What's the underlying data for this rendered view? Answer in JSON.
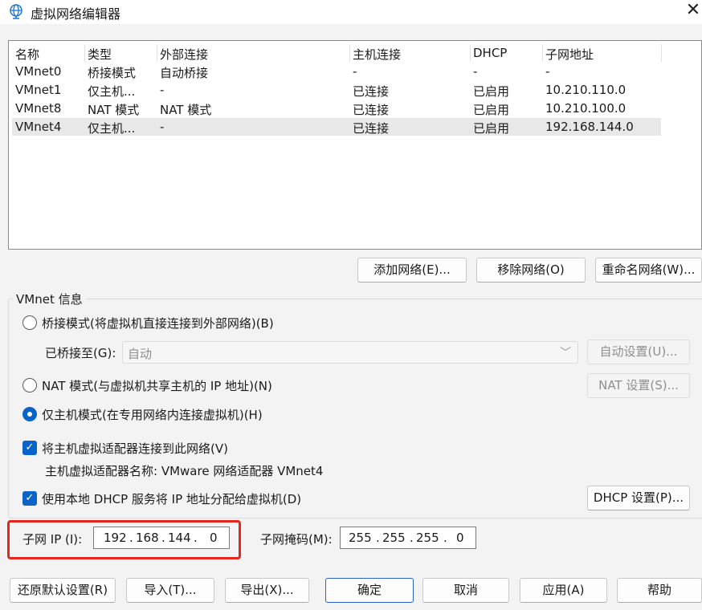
{
  "window": {
    "title": "虚拟网络编辑器",
    "close_symbol": "✕",
    "icon": "globe-icon"
  },
  "network_list": {
    "columns": [
      "名称",
      "类型",
      "外部连接",
      "主机连接",
      "DHCP",
      "子网地址"
    ],
    "rows": [
      [
        "VMnet0",
        "桥接模式",
        "自动桥接",
        "-",
        "-",
        "-"
      ],
      [
        "VMnet1",
        "仅主机...",
        "-",
        "已连接",
        "已启用",
        "10.210.110.0"
      ],
      [
        "VMnet8",
        "NAT 模式",
        "NAT 模式",
        "已连接",
        "已启用",
        "10.210.100.0"
      ],
      [
        "VMnet4",
        "仅主机...",
        "-",
        "已连接",
        "已启用",
        "192.168.144.0"
      ]
    ],
    "selected_row": 3
  },
  "list_buttons": {
    "add": "添加网络(E)...",
    "remove": "移除网络(O)",
    "rename": "重命名网络(W)..."
  },
  "vmnet_info": {
    "group_title": "VMnet 信息",
    "bridged_radio": "桥接模式(将虚拟机直接连接到外部网络)(B)",
    "bridged_to_label": "已桥接至(G):",
    "bridged_to_value": "自动",
    "chevron_symbol": "﹀",
    "auto_settings": "自动设置(U)...",
    "nat_radio": "NAT 模式(与虚拟机共享主机的 IP 地址)(N)",
    "nat_settings": "NAT 设置(S)...",
    "hostonly_radio": "仅主机模式(在专用网络内连接虚拟机)(H)",
    "selected_mode": "hostonly",
    "connect_adapter": "将主机虚拟适配器连接到此网络(V)",
    "connect_adapter_checked": true,
    "adapter_name": "主机虚拟适配器名称: VMware 网络适配器 VMnet4",
    "use_dhcp": "使用本地 DHCP 服务将 IP 地址分配给虚拟机(D)",
    "use_dhcp_checked": true,
    "check_symbol": "✓",
    "dhcp_settings": "DHCP 设置(P)..."
  },
  "subnet": {
    "ip_label": "子网 IP (I):",
    "ip_octets": [
      "192",
      "168",
      "144",
      "0"
    ],
    "mask_label": "子网掩码(M):",
    "mask_octets": [
      "255",
      "255",
      "255",
      "0"
    ],
    "dot": "."
  },
  "footer": {
    "restore": "还原默认设置(R)",
    "import": "导入(T)...",
    "export": "导出(X)...",
    "ok": "确定",
    "cancel": "取消",
    "apply": "应用(A)",
    "help": "帮助"
  },
  "colors": {
    "accent": "#0a63c9",
    "highlight": "#e4281f"
  }
}
